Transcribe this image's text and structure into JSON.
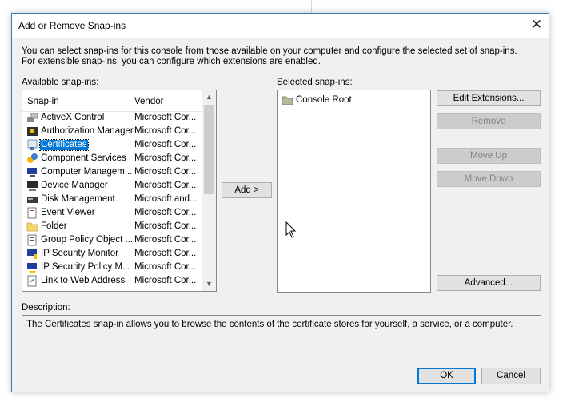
{
  "dialog": {
    "title": "Add or Remove Snap-ins",
    "intro": "You can select snap-ins for this console from those available on your computer and configure the selected set of snap-ins. For extensible snap-ins, you can configure which extensions are enabled."
  },
  "available": {
    "label": "Available snap-ins:",
    "columns": {
      "name": "Snap-in",
      "vendor": "Vendor"
    },
    "items": [
      {
        "name": "ActiveX Control",
        "vendor": "Microsoft Cor...",
        "icon": "activex-control-icon"
      },
      {
        "name": "Authorization Manager",
        "vendor": "Microsoft Cor...",
        "icon": "authorization-manager-icon"
      },
      {
        "name": "Certificates",
        "vendor": "Microsoft Cor...",
        "icon": "certificates-icon",
        "selected": true
      },
      {
        "name": "Component Services",
        "vendor": "Microsoft Cor...",
        "icon": "component-services-icon"
      },
      {
        "name": "Computer Managem...",
        "vendor": "Microsoft Cor...",
        "icon": "computer-management-icon"
      },
      {
        "name": "Device Manager",
        "vendor": "Microsoft Cor...",
        "icon": "device-manager-icon"
      },
      {
        "name": "Disk Management",
        "vendor": "Microsoft and...",
        "icon": "disk-management-icon"
      },
      {
        "name": "Event Viewer",
        "vendor": "Microsoft Cor...",
        "icon": "event-viewer-icon"
      },
      {
        "name": "Folder",
        "vendor": "Microsoft Cor...",
        "icon": "folder-icon"
      },
      {
        "name": "Group Policy Object ...",
        "vendor": "Microsoft Cor...",
        "icon": "group-policy-icon"
      },
      {
        "name": "IP Security Monitor",
        "vendor": "Microsoft Cor...",
        "icon": "ip-security-monitor-icon"
      },
      {
        "name": "IP Security Policy M...",
        "vendor": "Microsoft Cor...",
        "icon": "ip-security-policy-icon"
      },
      {
        "name": "Link to Web Address",
        "vendor": "Microsoft Cor...",
        "icon": "link-icon"
      }
    ]
  },
  "selected": {
    "label": "Selected snap-ins:",
    "items": [
      {
        "name": "Console Root",
        "icon": "console-root-folder-icon"
      }
    ]
  },
  "buttons": {
    "add": "Add >",
    "edit_extensions": "Edit Extensions...",
    "remove": "Remove",
    "move_up": "Move Up",
    "move_down": "Move Down",
    "advanced": "Advanced...",
    "ok": "OK",
    "cancel": "Cancel"
  },
  "description": {
    "label": "Description:",
    "text": "The Certificates snap-in allows you to browse the contents of the certificate stores for yourself, a service, or a computer."
  },
  "colors": {
    "selection": "#0078d7",
    "dialog_bg": "#f0f0f0",
    "border": "#3c7fb1"
  }
}
